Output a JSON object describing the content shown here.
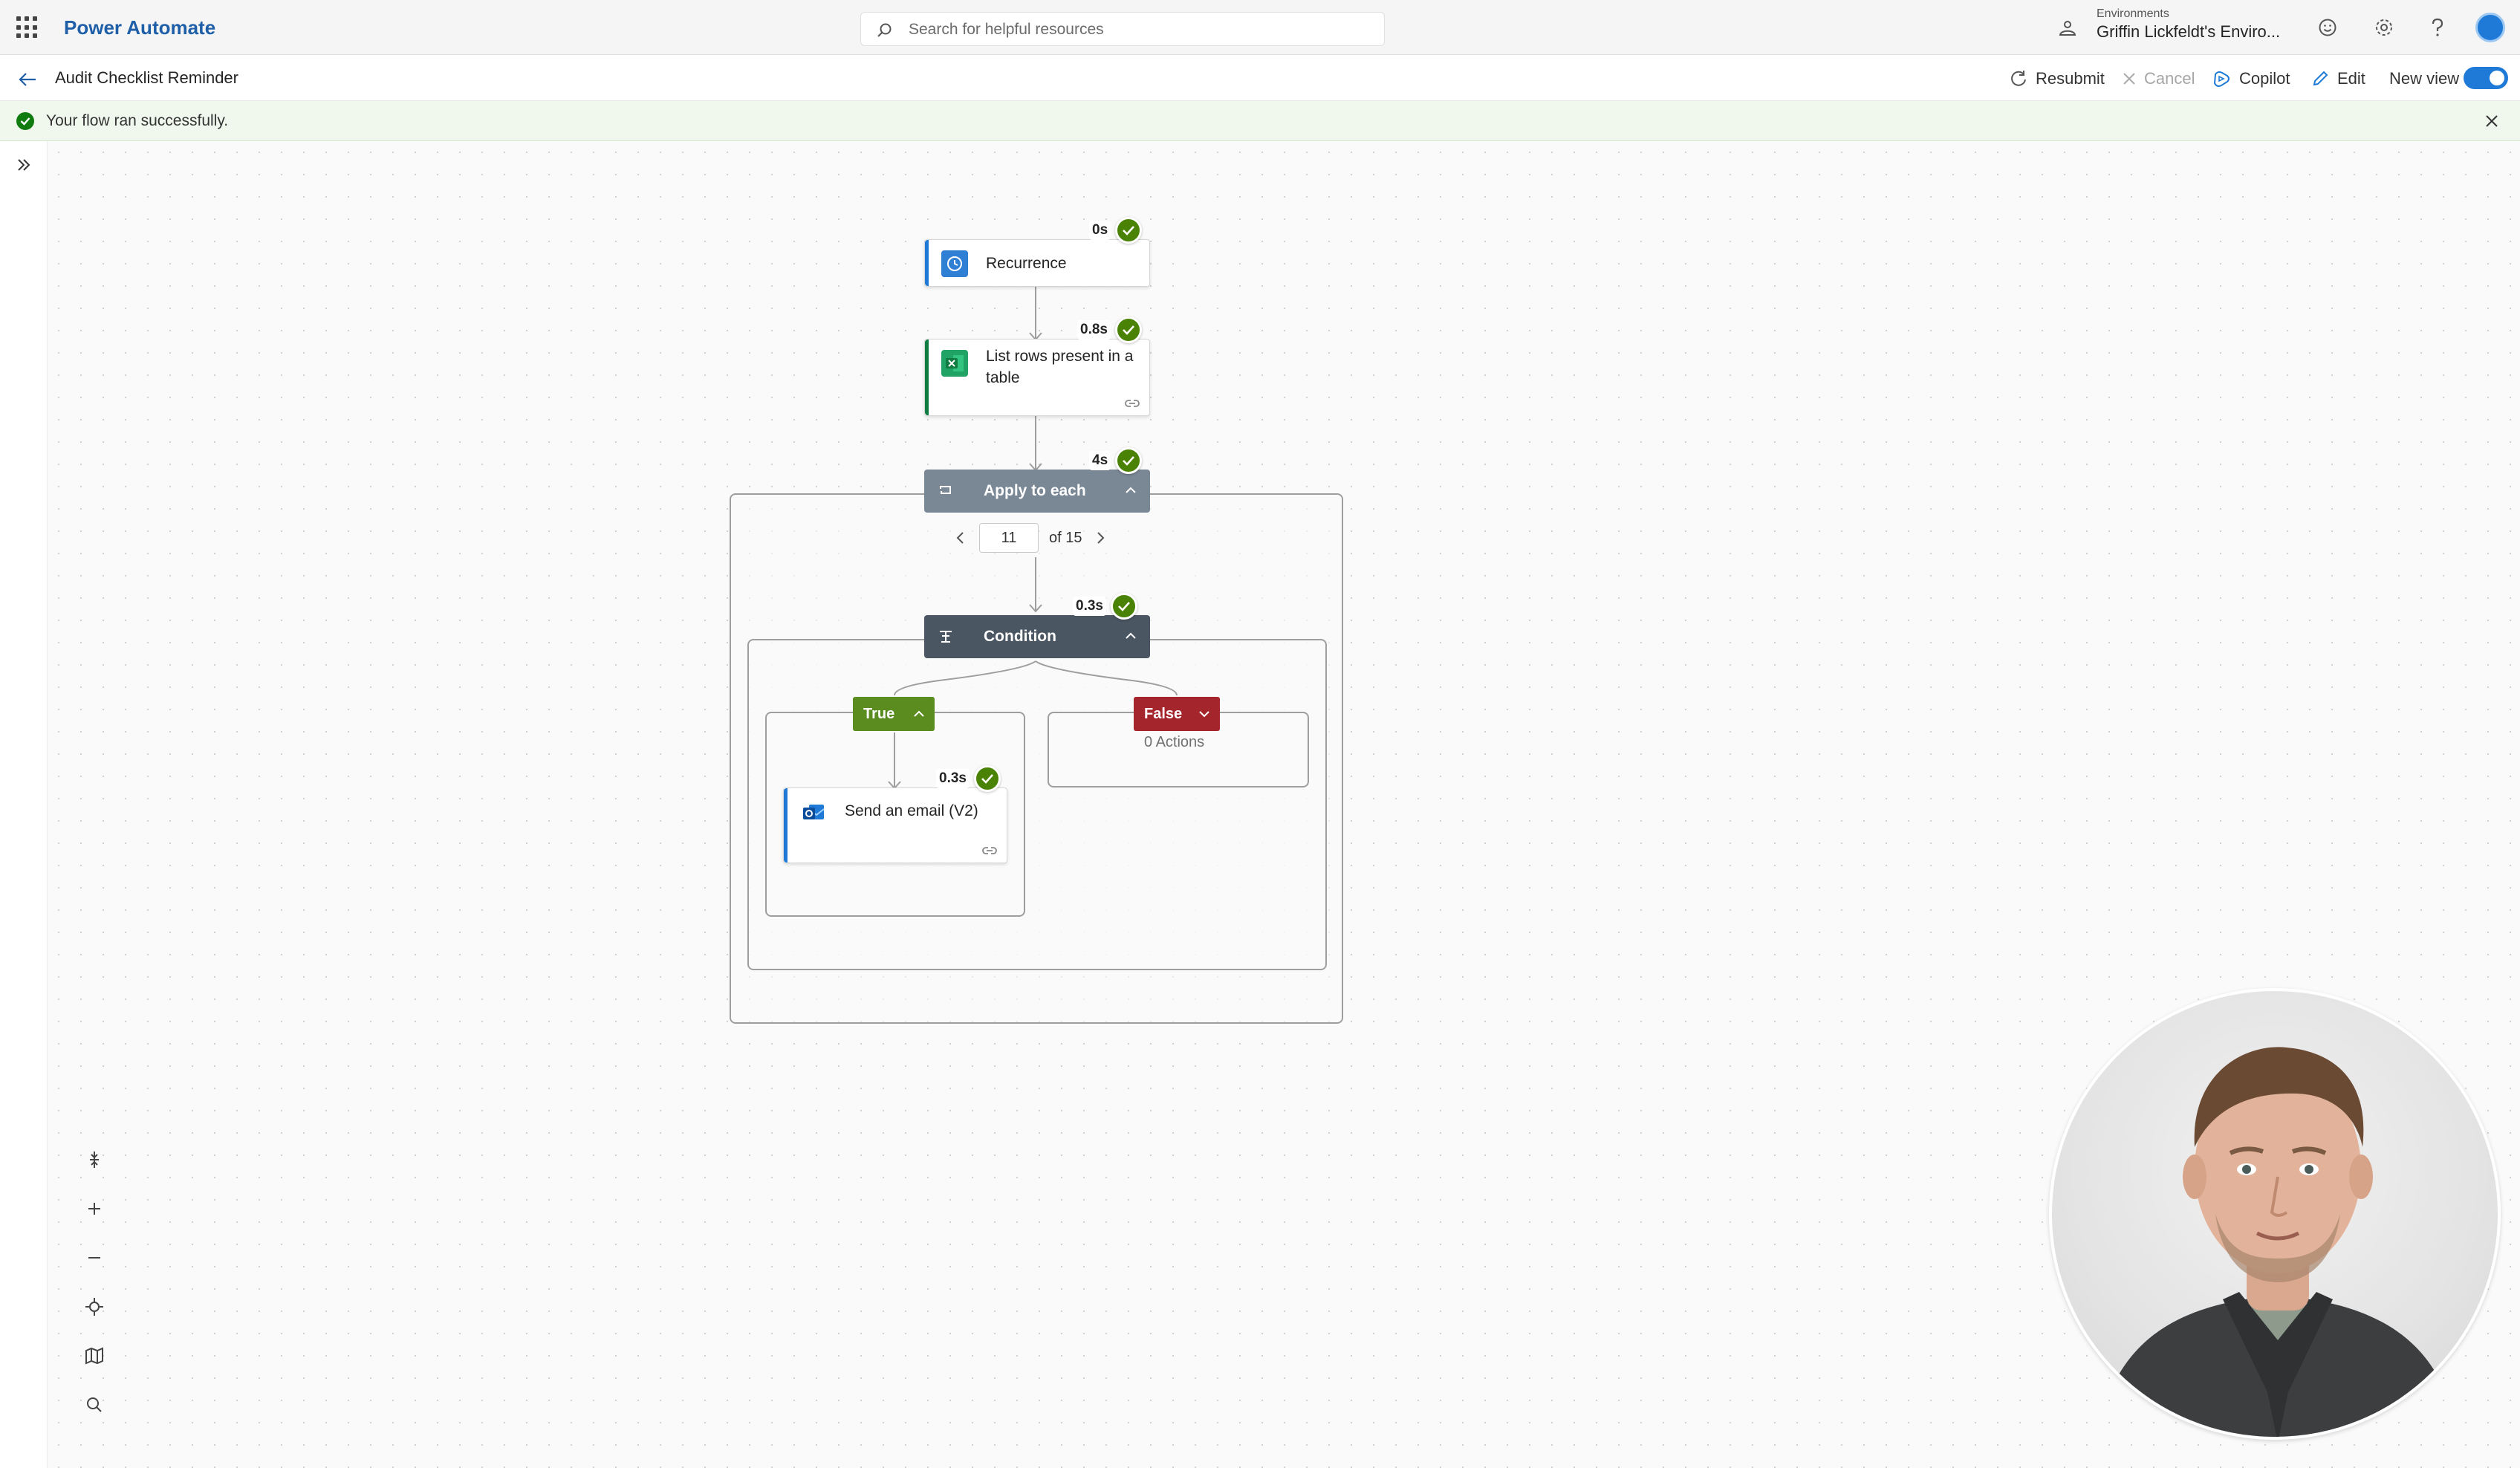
{
  "app": {
    "name": "Power Automate"
  },
  "search": {
    "placeholder": "Search for helpful resources"
  },
  "environment": {
    "label": "Environments",
    "name": "Griffin Lickfeldt's Enviro..."
  },
  "flow": {
    "title": "Audit Checklist Reminder"
  },
  "commands": {
    "resubmit": "Resubmit",
    "cancel": "Cancel",
    "copilot": "Copilot",
    "edit": "Edit",
    "new_view": "New view",
    "new_view_on": true
  },
  "banner": {
    "message": "Your flow ran successfully."
  },
  "nodes": {
    "recurrence": {
      "label": "Recurrence",
      "duration": "0s",
      "status": "succeeded"
    },
    "list_rows": {
      "label": "List rows present in a table",
      "duration": "0.8s",
      "status": "succeeded"
    },
    "apply_to_each": {
      "label": "Apply to each",
      "duration": "4s",
      "status": "succeeded",
      "iteration": "11",
      "of_label": "of 15"
    },
    "condition": {
      "label": "Condition",
      "duration": "0.3s",
      "status": "succeeded"
    },
    "true_branch": {
      "label": "True"
    },
    "false_branch": {
      "label": "False",
      "actions": "0 Actions"
    },
    "send_email": {
      "label": "Send an email (V2)",
      "duration": "0.3s",
      "status": "succeeded"
    }
  },
  "colors": {
    "brand": "#1f5fa8",
    "success": "#498205",
    "true_branch": "#5b8c1f",
    "false_branch": "#a4262c",
    "apply_header": "#7a8794",
    "condition_header": "#4b5663",
    "toggle": "#1e7ad6"
  },
  "icons": {
    "app_launcher": "waffle-icon",
    "search": "search-icon",
    "environment": "environment-icon",
    "feedback": "smiley-icon",
    "settings": "gear-icon",
    "help": "help-icon",
    "back": "arrow-left-icon",
    "resubmit": "refresh-icon",
    "cancel": "close-icon",
    "copilot": "copilot-icon",
    "edit": "pencil-icon",
    "banner_status": "checkmark-circle-icon",
    "expand": "double-chevron-right-icon",
    "fit": "fit-view-icon",
    "zoom_in": "plus-icon",
    "zoom_out": "minus-icon",
    "center": "center-icon",
    "minimap": "map-icon",
    "find": "search-icon"
  }
}
